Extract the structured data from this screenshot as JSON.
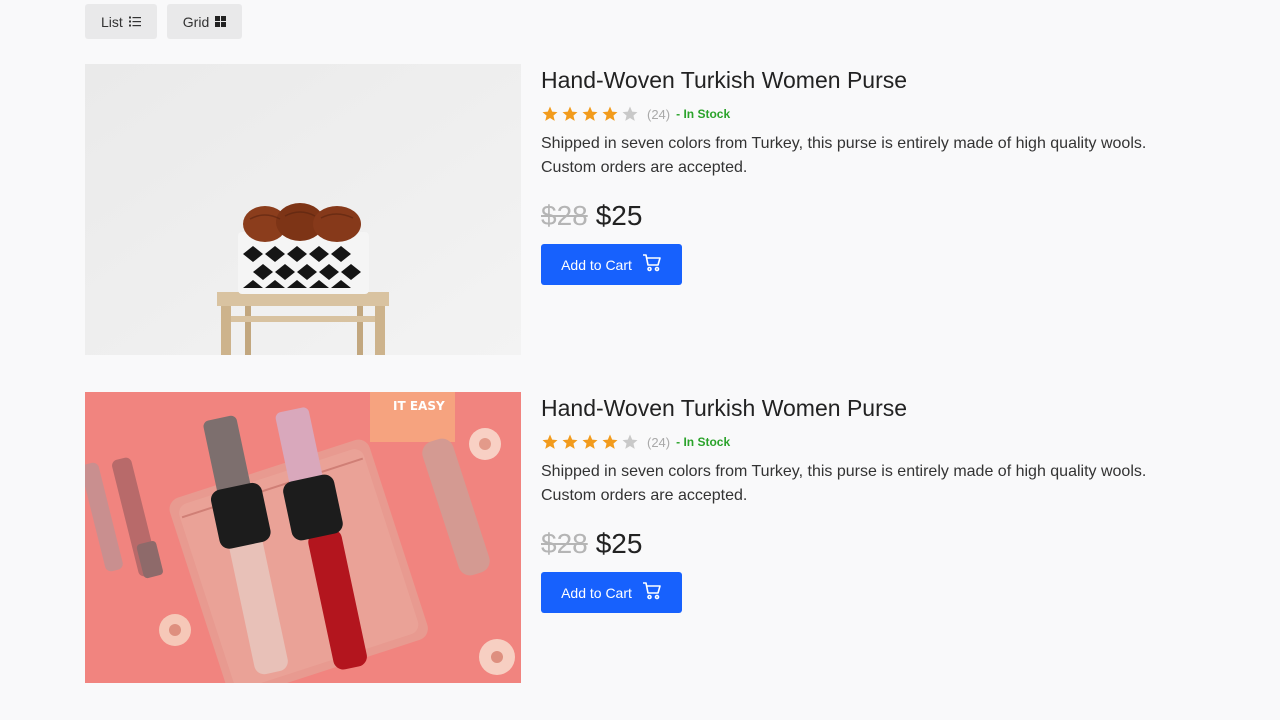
{
  "toolbar": {
    "list_label": "List",
    "list_icon": "list-icon",
    "grid_label": "Grid",
    "grid_icon": "grid-icon"
  },
  "products": [
    {
      "title": "Hand-Woven Turkish Women Purse",
      "rating": 4,
      "rating_max": 5,
      "review_count": "(24)",
      "stock": "- In Stock",
      "description": "Shipped in seven colors from Turkey, this purse is entirely made of high quality wools. Custom orders are accepted.",
      "old_price": "$28",
      "new_price": "$25",
      "cart_label": "Add to Cart",
      "cart_icon": "cart-icon"
    },
    {
      "title": "Hand-Woven Turkish Women Purse",
      "rating": 4,
      "rating_max": 5,
      "review_count": "(24)",
      "stock": "- In Stock",
      "description": "Shipped in seven colors from Turkey, this purse is entirely made of high quality wools. Custom orders are accepted.",
      "old_price": "$28",
      "new_price": "$25",
      "cart_label": "Add to Cart",
      "cart_icon": "cart-icon"
    }
  ],
  "colors": {
    "accent": "#1761fd",
    "star_filled": "#f29b1c",
    "star_empty": "#c9c9c9",
    "in_stock": "#2ba32b"
  }
}
